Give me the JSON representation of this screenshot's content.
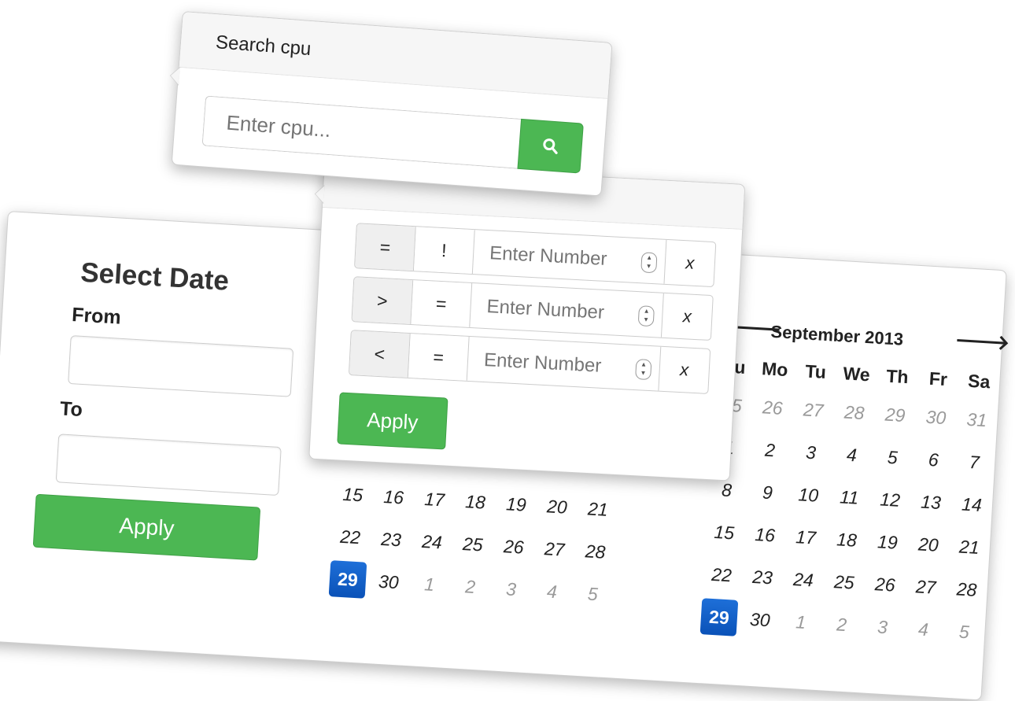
{
  "search": {
    "title": "Search cpu",
    "placeholder": "Enter cpu...",
    "button_icon": "search-icon"
  },
  "number_filter": {
    "rows": [
      {
        "op1": "=",
        "op2": "!",
        "placeholder": "Enter Number",
        "clear": "x"
      },
      {
        "op1": ">",
        "op2": "=",
        "placeholder": "Enter Number",
        "clear": "x"
      },
      {
        "op1": "<",
        "op2": "=",
        "placeholder": "Enter Number",
        "clear": "x"
      }
    ],
    "apply_label": "Apply"
  },
  "date_range": {
    "title": "Select Date",
    "from_label": "From",
    "to_label": "To",
    "apply_label": "Apply",
    "calendars": [
      {
        "month": "",
        "prev": "",
        "next": "",
        "weekdays": [],
        "weeks": [
          [
            {
              "d": "15"
            },
            {
              "d": "16"
            },
            {
              "d": "17"
            },
            {
              "d": "18"
            },
            {
              "d": "19"
            },
            {
              "d": "20"
            },
            {
              "d": "21"
            }
          ],
          [
            {
              "d": "22"
            },
            {
              "d": "23"
            },
            {
              "d": "24"
            },
            {
              "d": "25"
            },
            {
              "d": "26"
            },
            {
              "d": "27"
            },
            {
              "d": "28"
            }
          ],
          [
            {
              "d": "29",
              "sel": true
            },
            {
              "d": "30"
            },
            {
              "d": "1",
              "muted": true
            },
            {
              "d": "2",
              "muted": true
            },
            {
              "d": "3",
              "muted": true
            },
            {
              "d": "4",
              "muted": true
            },
            {
              "d": "5",
              "muted": true
            }
          ]
        ],
        "first_week_row": 3
      },
      {
        "month": "September 2013",
        "prev": "🡐",
        "next": "🡒",
        "weekdays": [
          "Su",
          "Mo",
          "Tu",
          "We",
          "Th",
          "Fr",
          "Sa"
        ],
        "weeks": [
          [
            {
              "d": "25",
              "muted": true
            },
            {
              "d": "26",
              "muted": true
            },
            {
              "d": "27",
              "muted": true
            },
            {
              "d": "28",
              "muted": true
            },
            {
              "d": "29",
              "muted": true
            },
            {
              "d": "30",
              "muted": true
            },
            {
              "d": "31",
              "muted": true
            }
          ],
          [
            {
              "d": "1"
            },
            {
              "d": "2"
            },
            {
              "d": "3"
            },
            {
              "d": "4"
            },
            {
              "d": "5"
            },
            {
              "d": "6"
            },
            {
              "d": "7"
            }
          ],
          [
            {
              "d": "8"
            },
            {
              "d": "9"
            },
            {
              "d": "10"
            },
            {
              "d": "11"
            },
            {
              "d": "12"
            },
            {
              "d": "13"
            },
            {
              "d": "14"
            }
          ],
          [
            {
              "d": "15"
            },
            {
              "d": "16"
            },
            {
              "d": "17"
            },
            {
              "d": "18"
            },
            {
              "d": "19"
            },
            {
              "d": "20"
            },
            {
              "d": "21"
            }
          ],
          [
            {
              "d": "22"
            },
            {
              "d": "23"
            },
            {
              "d": "24"
            },
            {
              "d": "25"
            },
            {
              "d": "26"
            },
            {
              "d": "27"
            },
            {
              "d": "28"
            }
          ],
          [
            {
              "d": "29",
              "sel": true
            },
            {
              "d": "30"
            },
            {
              "d": "1",
              "muted": true
            },
            {
              "d": "2",
              "muted": true
            },
            {
              "d": "3",
              "muted": true
            },
            {
              "d": "4",
              "muted": true
            },
            {
              "d": "5",
              "muted": true
            }
          ]
        ],
        "first_week_row": 0
      }
    ]
  },
  "colors": {
    "accent_green": "#4cb753",
    "selected_blue": "#0a52b8"
  }
}
